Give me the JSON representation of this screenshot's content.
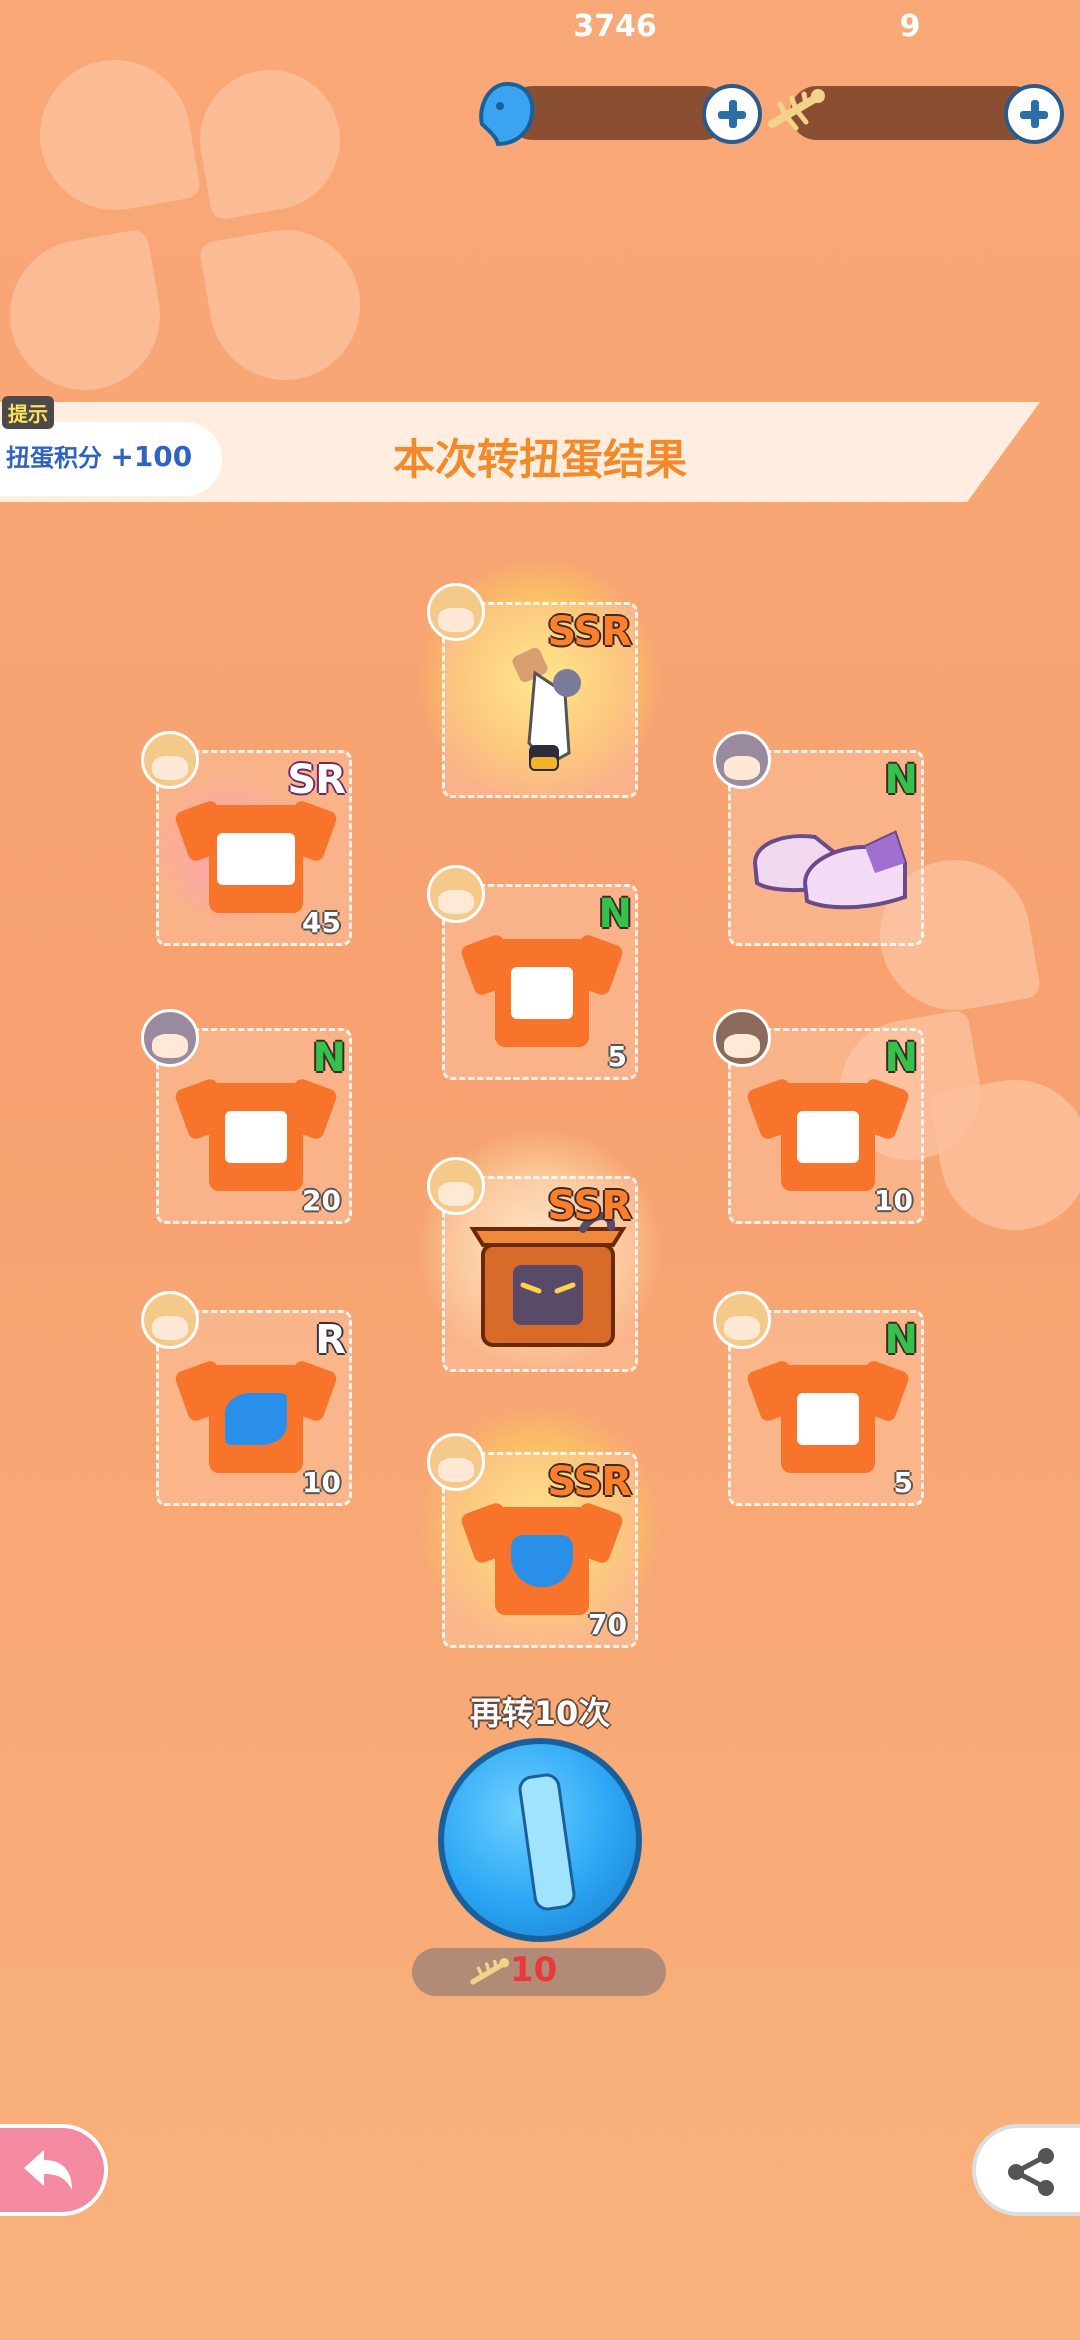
{
  "currencies": [
    {
      "name": "gem",
      "value": "3746"
    },
    {
      "name": "fishbone",
      "value": "9"
    }
  ],
  "tip": {
    "label": "提示",
    "text": "扭蛋积分",
    "value": "+100"
  },
  "banner": {
    "title": "本次转扭蛋结果"
  },
  "items": [
    {
      "rarity": "SSR",
      "qty": "",
      "type": "figure"
    },
    {
      "rarity": "SR",
      "qty": "45",
      "type": "tshirt"
    },
    {
      "rarity": "N",
      "qty": "",
      "type": "shoes"
    },
    {
      "rarity": "N",
      "qty": "5",
      "type": "tshirt"
    },
    {
      "rarity": "N",
      "qty": "20",
      "type": "tshirt"
    },
    {
      "rarity": "N",
      "qty": "10",
      "type": "tshirt"
    },
    {
      "rarity": "SSR",
      "qty": "",
      "type": "box"
    },
    {
      "rarity": "R",
      "qty": "10",
      "type": "tshirt"
    },
    {
      "rarity": "N",
      "qty": "5",
      "type": "tshirt"
    },
    {
      "rarity": "SSR",
      "qty": "70",
      "type": "tshirt"
    }
  ],
  "respin": {
    "label": "再转10次",
    "cost": "10"
  },
  "icons": {
    "back": "back-arrow-icon",
    "share": "share-icon",
    "currency1": "gem-icon",
    "currency2": "fishbone-icon"
  },
  "colors": {
    "accent": "#f38a2a",
    "button": "#2aa6f5",
    "back": "#f48aa2"
  }
}
